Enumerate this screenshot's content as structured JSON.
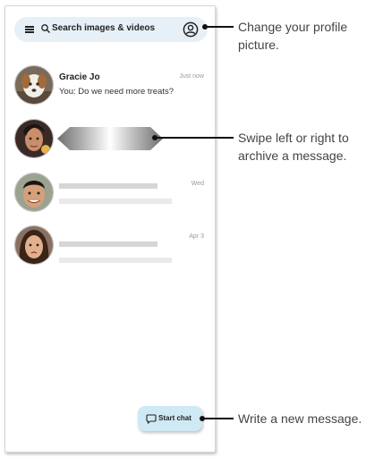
{
  "search": {
    "placeholder": "Search images & videos",
    "menu_icon": "menu-icon",
    "search_icon": "search-icon",
    "profile_icon": "account-circle-icon"
  },
  "conversations": [
    {
      "name": "Gracie Jo",
      "message": "You: Do we need more treats?",
      "time": "Just now",
      "avatar": "dog-avatar"
    },
    {
      "name": "",
      "message": "",
      "time": "",
      "avatar": "woman-avatar",
      "swiping": true
    },
    {
      "name": "",
      "message": "",
      "time": "Wed",
      "avatar": "man-avatar"
    },
    {
      "name": "",
      "message": "",
      "time": "Apr 3",
      "avatar": "girl-avatar"
    }
  ],
  "start_chat": {
    "label": "Start chat",
    "icon": "chat-bubble-icon"
  },
  "callouts": {
    "profile": "Change your profile picture.",
    "swipe": "Swipe left or right to archive a message.",
    "new_message": "Write a new message."
  }
}
